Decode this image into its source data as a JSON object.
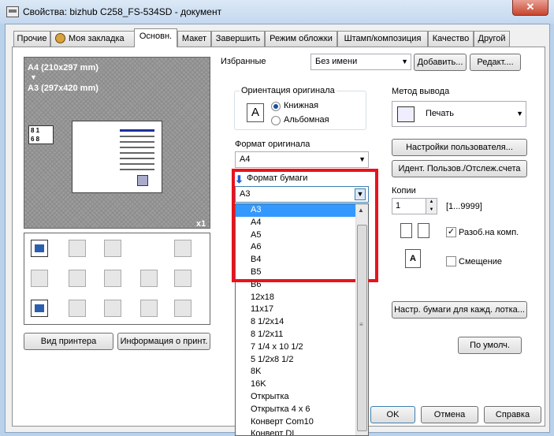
{
  "window": {
    "title": "Свойства: bizhub C258_FS-534SD - документ",
    "close_glyph": "✕"
  },
  "tabs": [
    {
      "label": "Прочие"
    },
    {
      "label": "Моя закладка"
    },
    {
      "label": "Основн."
    },
    {
      "label": "Макет"
    },
    {
      "label": "Завершить"
    },
    {
      "label": "Режим обложки"
    },
    {
      "label": "Штамп/композиция"
    },
    {
      "label": "Качество"
    },
    {
      "label": "Другой"
    }
  ],
  "preview": {
    "line1": "A4 (210x297 mm)",
    "arrow": "▼",
    "line2": "A3 (297x420 mm)",
    "copies_tag": "x1",
    "mini_icon": {
      "top": "8 1",
      "bottom": "6 8"
    }
  },
  "left_buttons": {
    "printer_view": "Вид принтера",
    "printer_info": "Информация о принт."
  },
  "favorites": {
    "label": "Избранные",
    "value": "Без имени",
    "add": "Добавить...",
    "edit": "Редакт...."
  },
  "orientation": {
    "group_label": "Ориентация оригинала",
    "portrait": "Книжная",
    "landscape": "Альбомная",
    "selected": "Книжная",
    "icon_letter": "A"
  },
  "original_format": {
    "label": "Формат оригинала",
    "value": "A4"
  },
  "paper_format": {
    "label": "Формат бумаги",
    "value": "A3"
  },
  "dropdown": {
    "selected": "A3",
    "items": [
      "A3",
      "A4",
      "A5",
      "A6",
      "B4",
      "B5",
      "B6",
      "12x18",
      "11x17",
      "8 1/2x14",
      "8 1/2x11",
      "7 1/4 x 10 1/2",
      "5 1/2x8 1/2",
      "8K",
      "16K",
      "Открытка",
      "Открытка 4 x 6",
      "Конверт Com10",
      "Конверт DL"
    ]
  },
  "output_method": {
    "label": "Метод вывода",
    "value": "Печать"
  },
  "user_settings_button": "Настройки пользователя...",
  "user_auth_button": "Идент. Пользов./Отслеж.счета",
  "copies": {
    "label": "Копии",
    "value": "1",
    "range": "[1...9999]"
  },
  "collate": {
    "label": "Разоб.на комп.",
    "checked": true
  },
  "offset": {
    "label": "Смещение",
    "checked": false
  },
  "paper_per_tray_button": "Настр. бумаги для кажд. лотка...",
  "default_button": "По умолч.",
  "footer": {
    "ok": "OK",
    "cancel": "Отмена",
    "help": "Справка"
  }
}
